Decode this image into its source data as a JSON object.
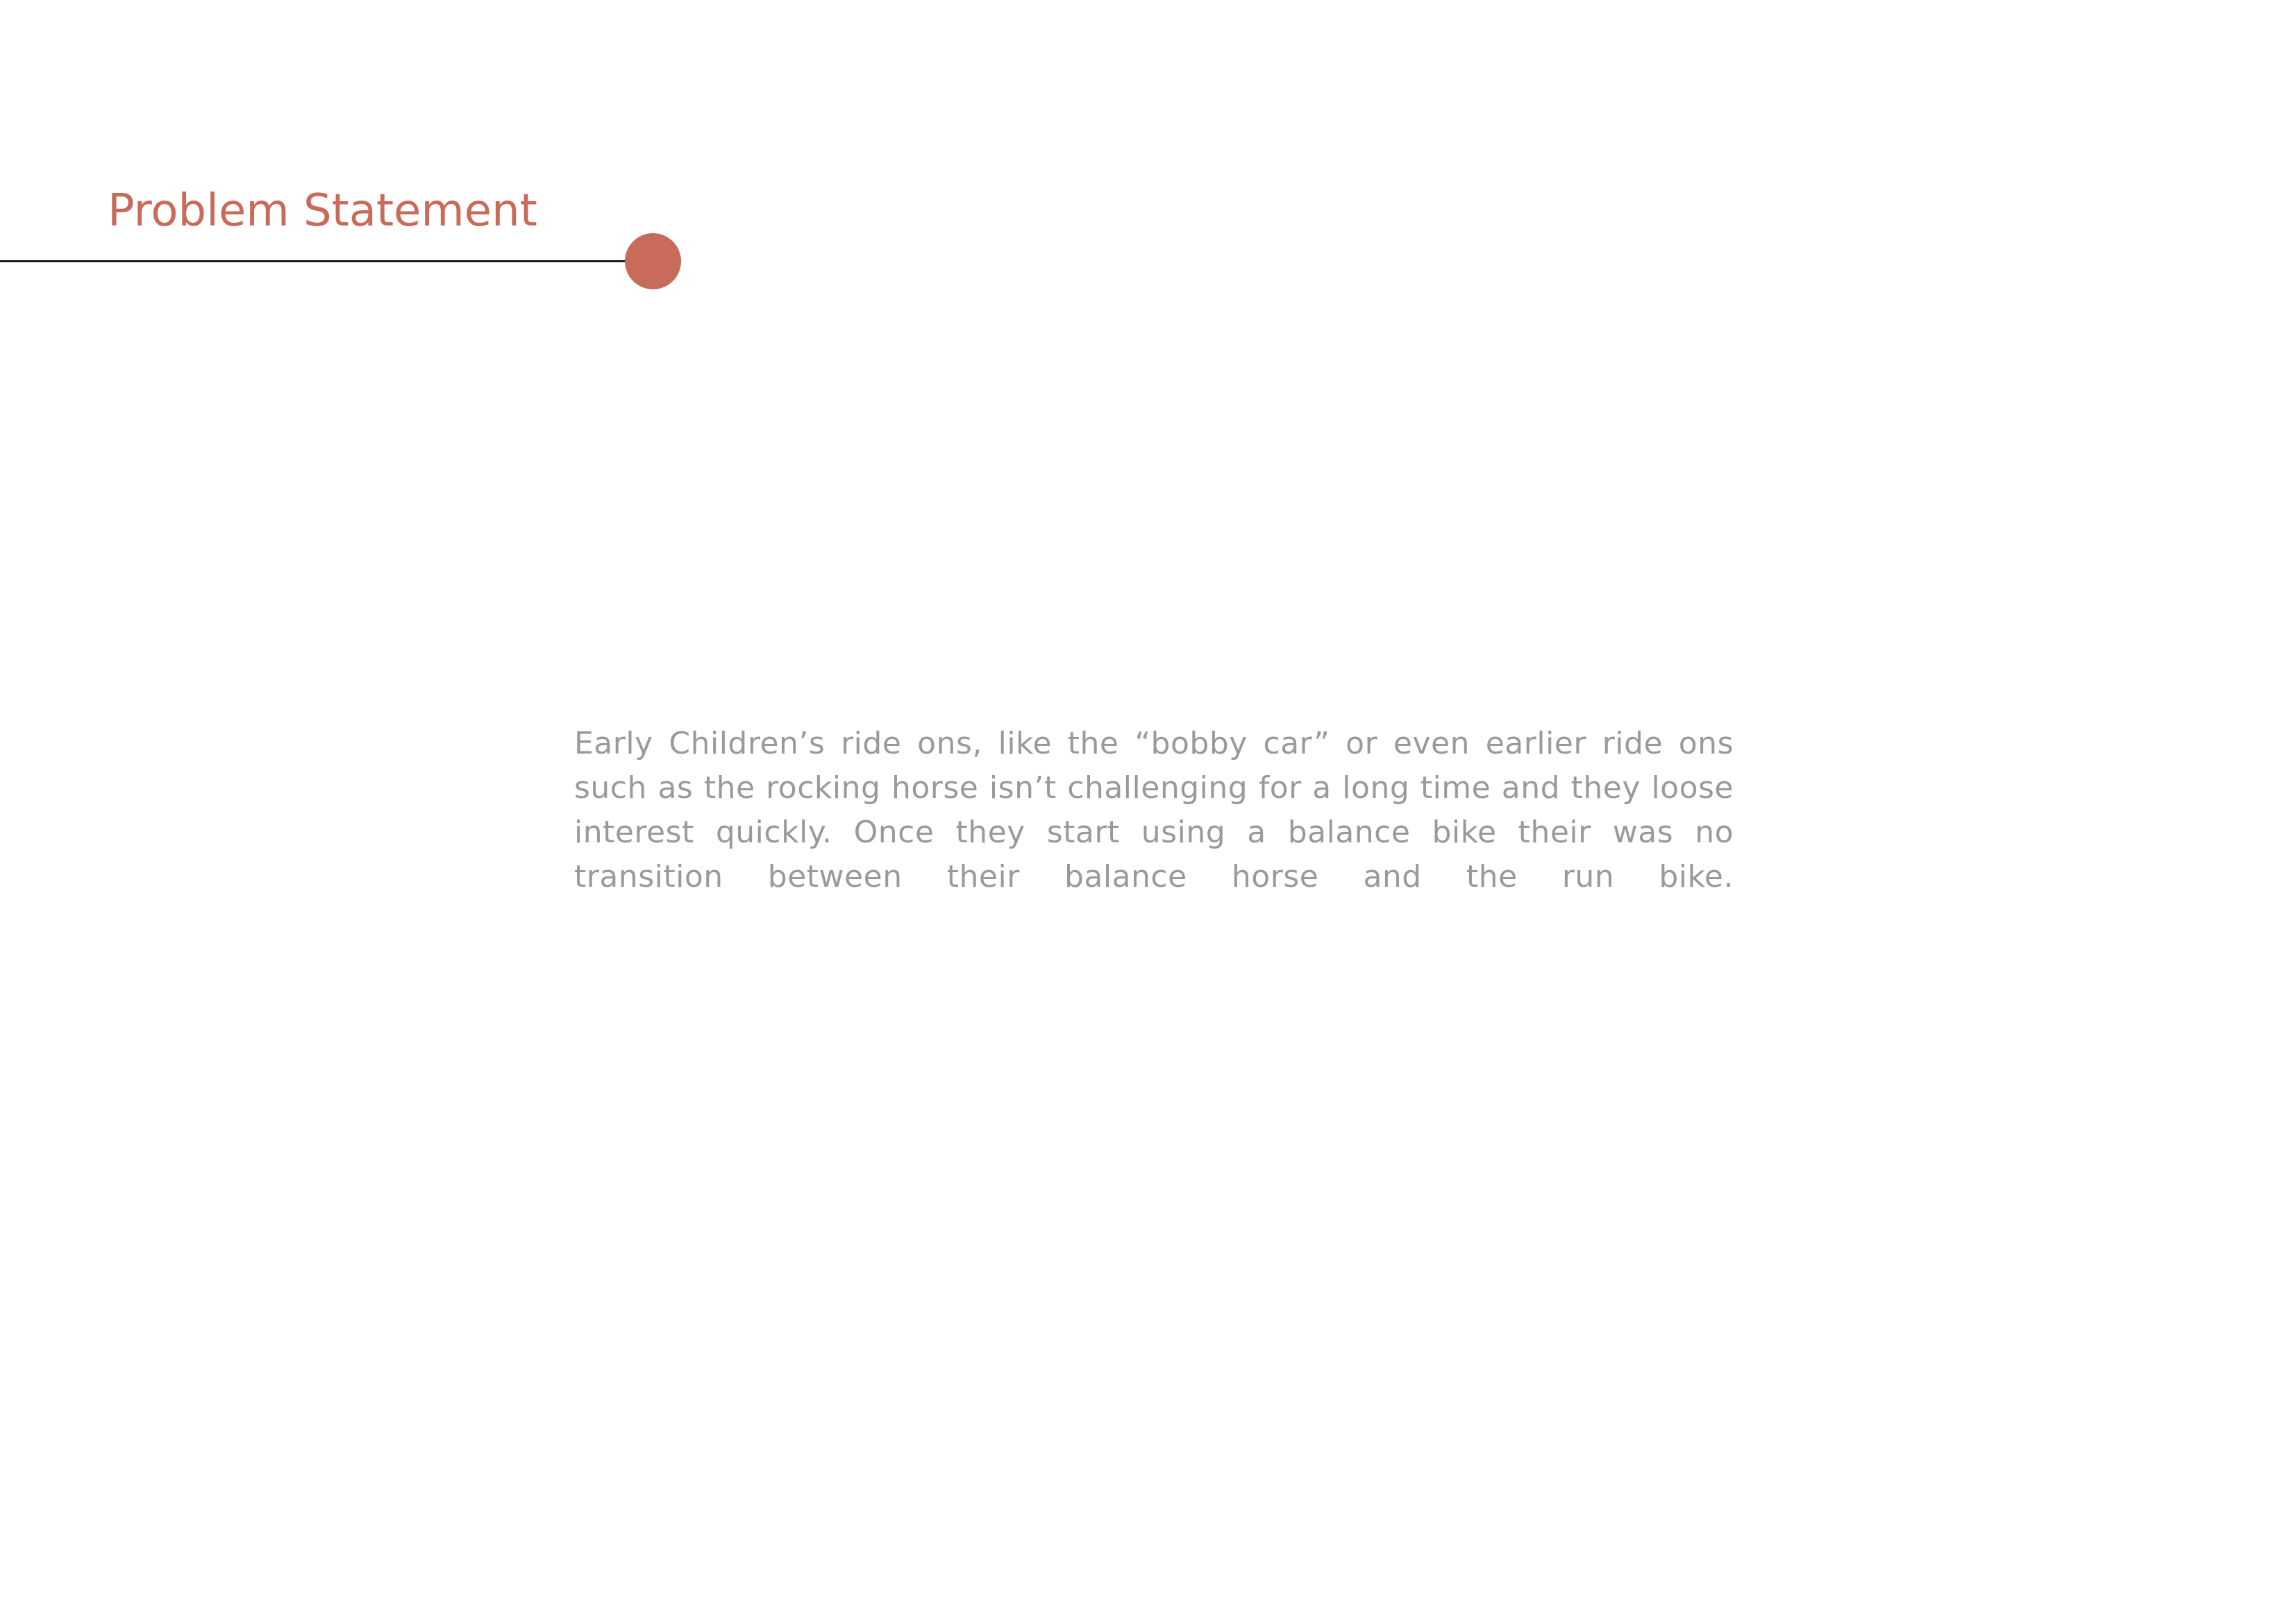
{
  "colors": {
    "accent": "#c86b5b",
    "rule": "#1a1a1a",
    "body": "#9a9a9a"
  },
  "page": {
    "title": "Problem Statement",
    "body": "Early Children’s ride ons, like the “bobby car” or even earlier ride ons such as the rocking horse isn’t challenging for a long time and they loose interest quickly. Once they start using a balance bike their was no transition between their balance horse and the run bike."
  }
}
